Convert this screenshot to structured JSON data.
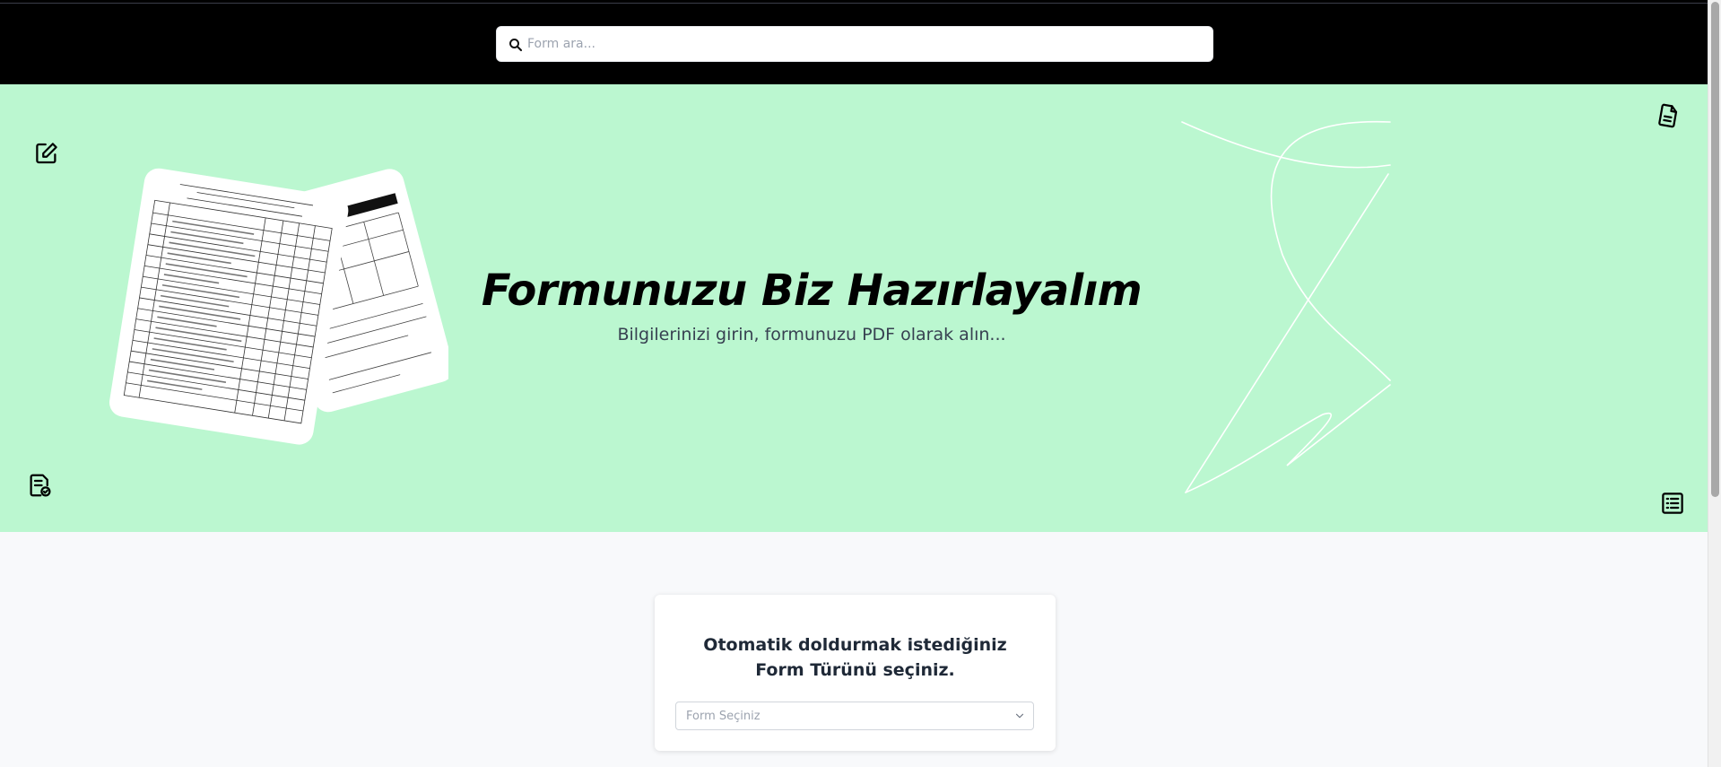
{
  "search": {
    "placeholder": "Form ara...",
    "icon": "search-icon"
  },
  "hero": {
    "title": "Formunuzu Biz Hazırlayalım",
    "subtitle": "Bilgilerinizi girin, formunuzu PDF olarak alın...",
    "background": "#bbf7d0",
    "icons": {
      "top_left": "edit-icon",
      "bottom_left": "document-check-icon",
      "top_right": "document-icon",
      "bottom_right": "list-icon"
    }
  },
  "form_select": {
    "heading": "Otomatik doldurmak istediğiniz Form Türünü seçiniz.",
    "selected_value": "Form Seçiniz"
  },
  "colors": {
    "topbar": "#000000",
    "hero": "#bbf7d0",
    "page": "#f8f9fb"
  }
}
